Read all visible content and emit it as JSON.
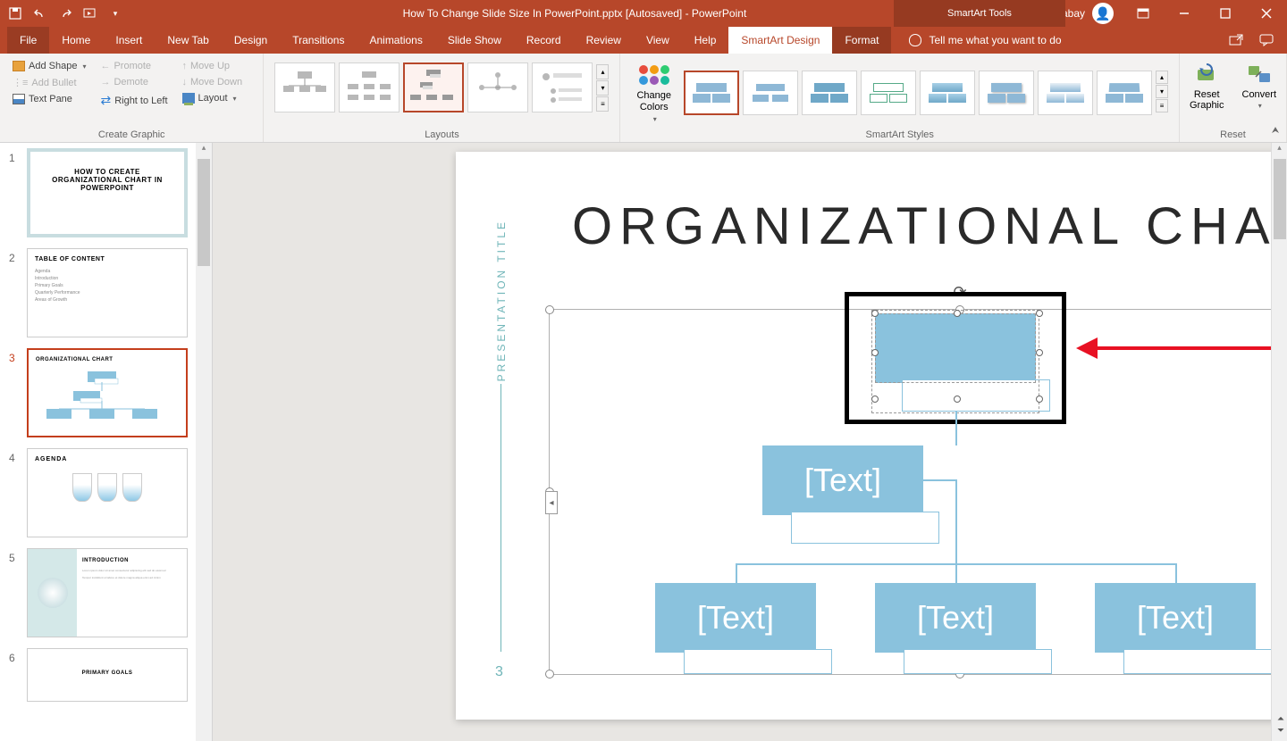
{
  "titlebar": {
    "title": "How To Change Slide Size In PowerPoint.pptx [Autosaved]  -  PowerPoint",
    "toolsTitle": "SmartArt Tools",
    "user": "Dina Jane Abay-abay"
  },
  "tabs": {
    "file": "File",
    "home": "Home",
    "insert": "Insert",
    "newtab": "New Tab",
    "design": "Design",
    "transitions": "Transitions",
    "animations": "Animations",
    "slideshow": "Slide Show",
    "record": "Record",
    "review": "Review",
    "view": "View",
    "help": "Help",
    "smartartDesign": "SmartArt Design",
    "format": "Format",
    "tellme": "Tell me what you want to do"
  },
  "ribbon": {
    "createGraphic": {
      "addShape": "Add Shape",
      "addBullet": "Add Bullet",
      "textPane": "Text Pane",
      "promote": "Promote",
      "demote": "Demote",
      "rtl": "Right to Left",
      "moveUp": "Move Up",
      "moveDown": "Move Down",
      "layout": "Layout",
      "label": "Create Graphic"
    },
    "layouts": {
      "label": "Layouts"
    },
    "changeColors": "Change Colors",
    "styles": {
      "label": "SmartArt Styles"
    },
    "reset": {
      "resetGraphic": "Reset Graphic",
      "convert": "Convert",
      "label": "Reset"
    }
  },
  "thumbs": [
    {
      "n": "1",
      "title": "HOW TO CREATE ORGANIZATIONAL CHART IN POWERPOINT"
    },
    {
      "n": "2",
      "title": "TABLE OF CONTENT",
      "items": [
        "Agenda",
        "Introduction",
        "Primary Goals",
        "Quarterly Performance",
        "Areas of Growth"
      ]
    },
    {
      "n": "3",
      "title": "ORGANIZATIONAL CHART"
    },
    {
      "n": "4",
      "title": "AGENDA"
    },
    {
      "n": "5",
      "title": "INTRODUCTION"
    },
    {
      "n": "6",
      "title": "PRIMARY GOALS"
    }
  ],
  "slide": {
    "sideTitle": "PRESENTATION TITLE",
    "sideNum": "3",
    "title": "ORGANIZATIONAL CHART",
    "nodePlaceholder": "[Text]"
  }
}
